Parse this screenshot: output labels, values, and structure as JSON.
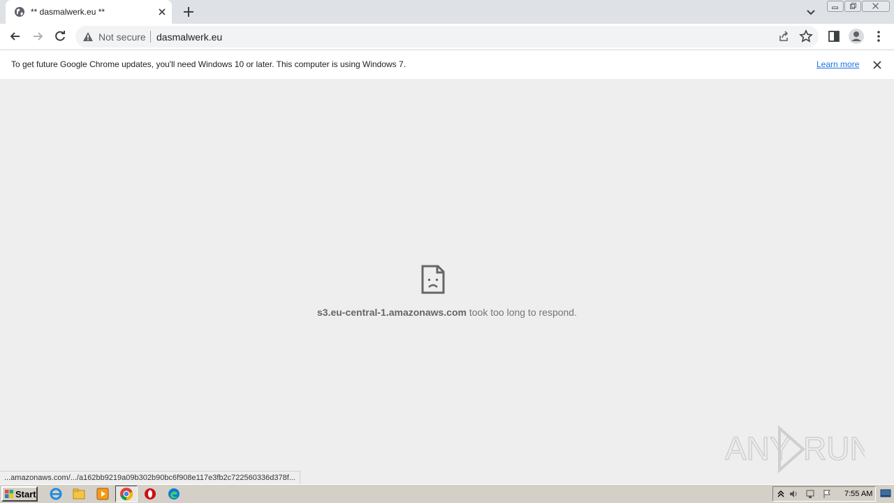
{
  "browser": {
    "tab": {
      "title": "** dasmalwerk.eu **"
    },
    "omnibox": {
      "security_label": "Not secure",
      "url": "dasmalwerk.eu"
    }
  },
  "infobar": {
    "message": "To get future Google Chrome updates, you'll need Windows 10 or later. This computer is using Windows 7.",
    "link": "Learn more"
  },
  "error": {
    "host": "s3.eu-central-1.amazonaws.com",
    "message": " took too long to respond."
  },
  "statusbar": {
    "link_preview": "...amazonaws.com/.../a162bb9219a09b302b90bc6f908e117e3fb2c722560336d378f..."
  },
  "watermark": {
    "text": "ANY RUN"
  },
  "taskbar": {
    "start_label": "Start",
    "apps": [
      "internet-explorer-icon",
      "file-explorer-icon",
      "media-player-icon",
      "chrome-icon",
      "opera-icon",
      "edge-icon"
    ],
    "clock": "7:55 AM"
  }
}
